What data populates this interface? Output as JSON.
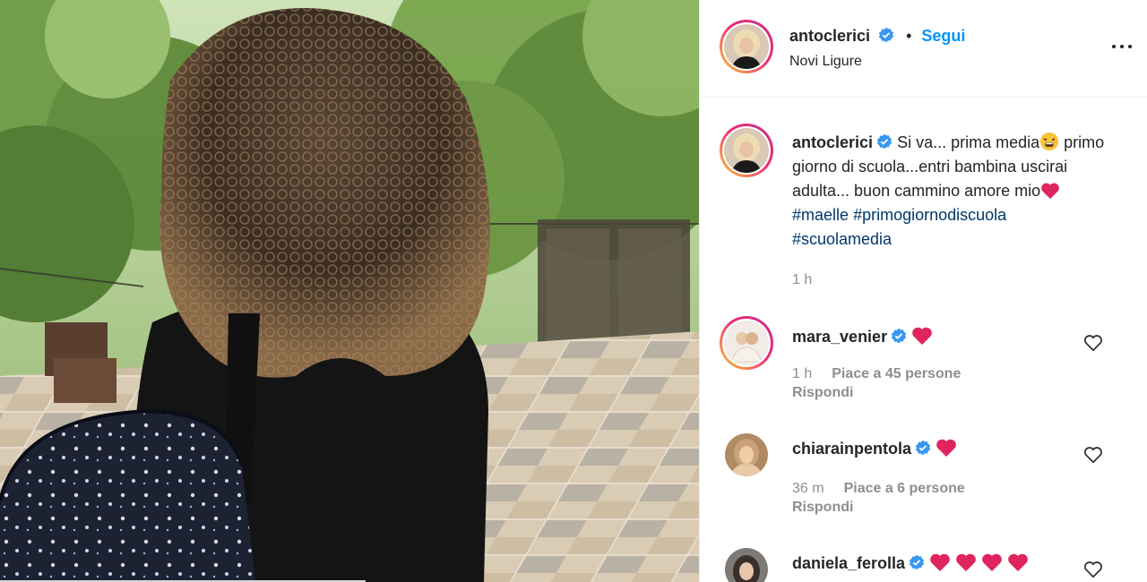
{
  "header": {
    "username": "antoclerici",
    "follow_label": "Segui",
    "location": "Novi Ligure"
  },
  "caption": {
    "username": "antoclerici",
    "text_1": "Si va... prima media",
    "text_2": " primo giorno di scuola...entri bambina uscirai adulta... buon cammino amore mio",
    "hashtags": [
      "#maelle",
      "#primogiornodiscuola",
      "#scuolamedia"
    ],
    "time": "1 h"
  },
  "comments": [
    {
      "username": "mara_venier",
      "hearts": 1,
      "time": "1 h",
      "likes": "Piace a 45 persone",
      "reply": "Rispondi"
    },
    {
      "username": "chiarainpentola",
      "hearts": 1,
      "time": "36 m",
      "likes": "Piace a 6 persone",
      "reply": "Rispondi"
    },
    {
      "username": "daniela_ferolla",
      "hearts": 4
    }
  ],
  "colors": {
    "accent": "#0095f6",
    "verified": "#3897f0",
    "heart": "#e0245e",
    "muted": "#8e8e8e",
    "hashtag": "#00376b"
  },
  "icons": {
    "verified": "verified-badge-icon",
    "more": "more-options-icon",
    "like": "heart-outline-icon"
  }
}
